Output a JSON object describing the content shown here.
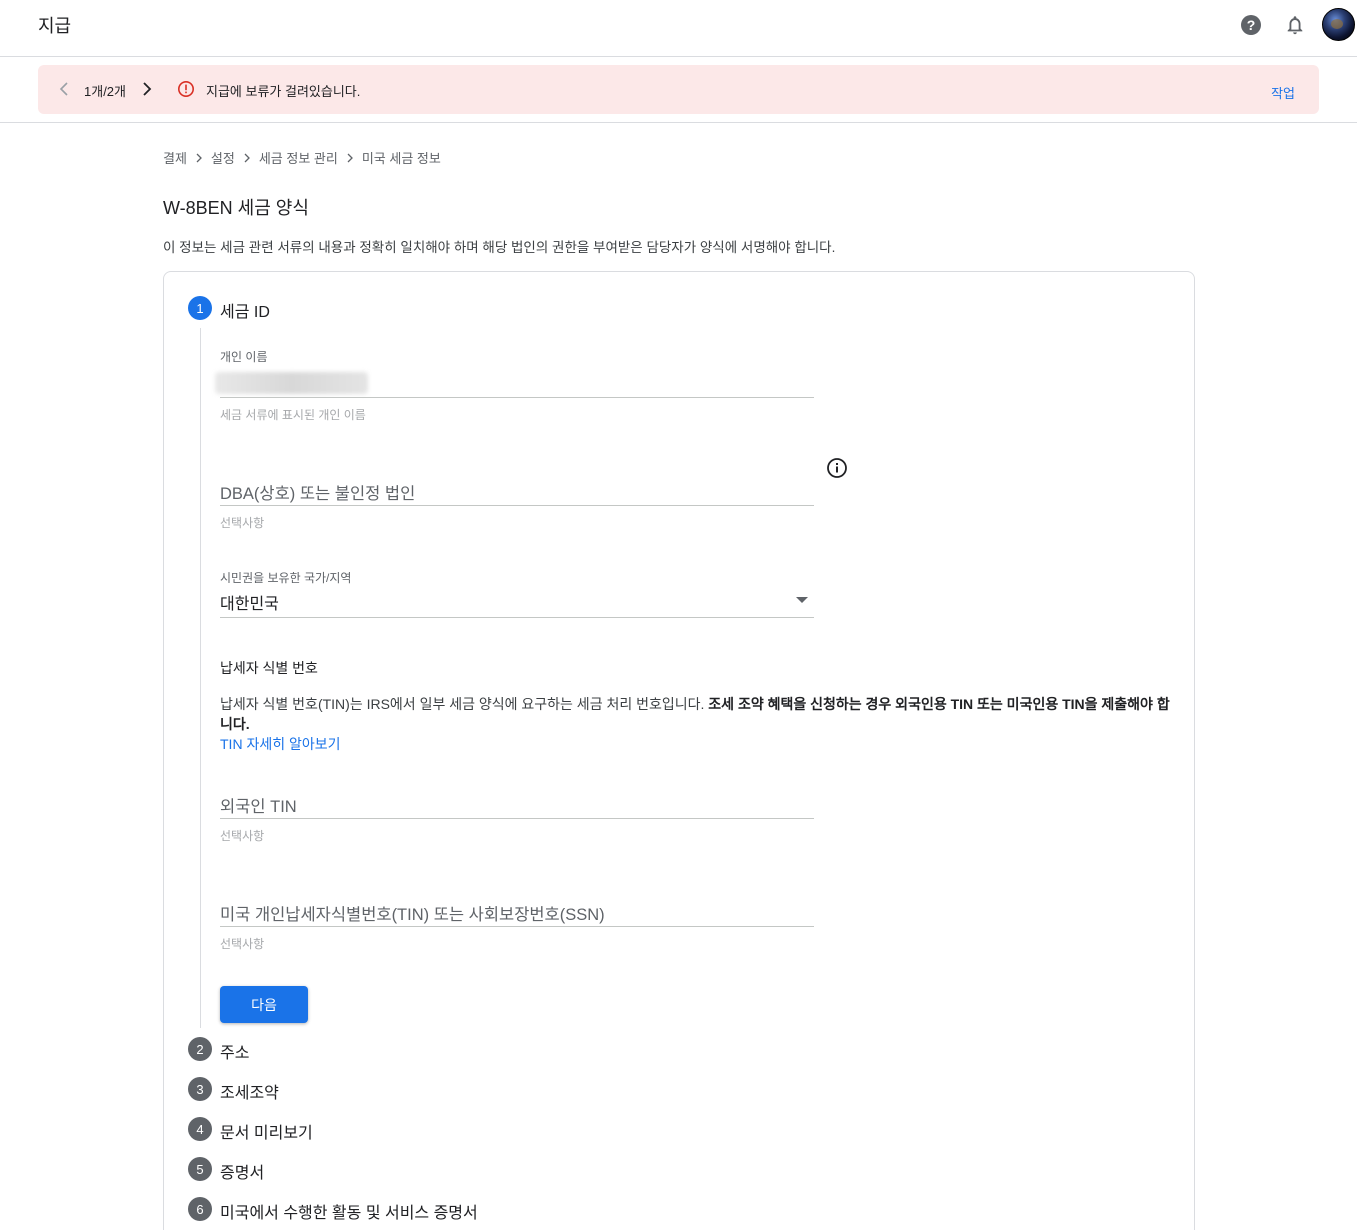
{
  "header": {
    "title": "지급",
    "help_icon": "help-circle-icon",
    "notifications_icon": "bell-icon",
    "avatar_icon": "profile-avatar"
  },
  "alert": {
    "pager": "1개/2개",
    "message": "지급에 보류가 걸려있습니다.",
    "action_label": "작업",
    "bg_color": "#fce8e8",
    "icon_color": "#d93025"
  },
  "breadcrumb": [
    "결제",
    "설정",
    "세금 정보 관리",
    "미국 세금 정보"
  ],
  "page": {
    "title": "W-8BEN 세금 양식",
    "description": "이 정보는 세금 관련 서류의 내용과 정확히 일치해야 하며 해당 법인의 권한을 부여받은 담당자가 양식에 서명해야 합니다."
  },
  "steps": [
    {
      "number": "1",
      "label": "세금 ID",
      "active": true
    },
    {
      "number": "2",
      "label": "주소",
      "active": false
    },
    {
      "number": "3",
      "label": "조세조약",
      "active": false
    },
    {
      "number": "4",
      "label": "문서 미리보기",
      "active": false
    },
    {
      "number": "5",
      "label": "증명서",
      "active": false
    },
    {
      "number": "6",
      "label": "미국에서 수행한 활동 및 서비스 증명서",
      "active": false
    }
  ],
  "form": {
    "individual_name": {
      "label": "개인 이름",
      "value": "",
      "hint": "세금 서류에 표시된 개인 이름"
    },
    "dba": {
      "placeholder": "DBA(상호) 또는 불인정 법인",
      "hint": "선택사항"
    },
    "citizenship": {
      "label": "시민권을 보유한 국가/지역",
      "value": "대한민국"
    },
    "tin_section": {
      "title": "납세자 식별 번호",
      "body_plain": "납세자 식별 번호(TIN)는 IRS에서 일부 세금 양식에 요구하는 세금 처리 번호입니다. ",
      "body_bold": "조세 조약 혜택을 신청하는 경우 외국인용 TIN 또는 미국인용 TIN을 제출해야 합니다.",
      "learn_more": "TIN 자세히 알아보기"
    },
    "foreign_tin": {
      "placeholder": "외국인 TIN",
      "hint": "선택사항"
    },
    "us_tin": {
      "placeholder": "미국 개인납세자식별번호(TIN) 또는 사회보장번호(SSN)",
      "hint": "선택사항"
    },
    "next_button": "다음"
  },
  "colors": {
    "accent": "#1a73e8",
    "step_inactive": "#5f6368"
  }
}
